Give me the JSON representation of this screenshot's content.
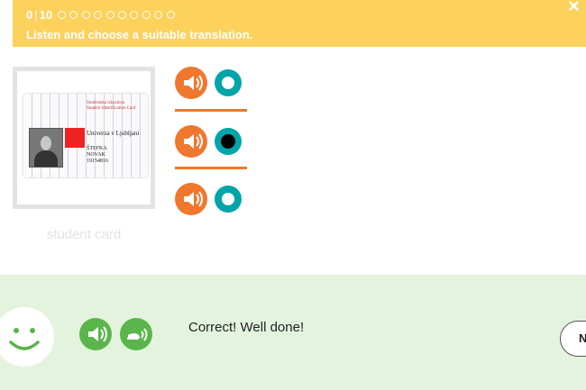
{
  "header": {
    "progress_current": "0",
    "progress_separator": "|",
    "progress_total": "10",
    "dot_count": 10,
    "instruction": "Listen and choose a suitable translation.",
    "close_glyph": "×"
  },
  "image": {
    "caption": "student card",
    "card_text": {
      "org_line1": "Studentska izkaznica",
      "org_line2": "Student Identification Card",
      "university": "Univerza v Ljubljani",
      "name1": "ŠTEFKA",
      "name2": "NOVAK",
      "number": "19154816"
    }
  },
  "options": [
    {
      "id": "option-1",
      "selected": false
    },
    {
      "id": "option-2",
      "selected": true
    },
    {
      "id": "option-3",
      "selected": false
    }
  ],
  "feedback": {
    "message": "Correct! Well done!",
    "next_label": "N"
  },
  "colors": {
    "header_bg": "#fcd15c",
    "speaker": "#f0772e",
    "radio": "#00a5aa",
    "feedback_bg": "#e3f3dd",
    "feedback_button": "#5ab54b"
  }
}
